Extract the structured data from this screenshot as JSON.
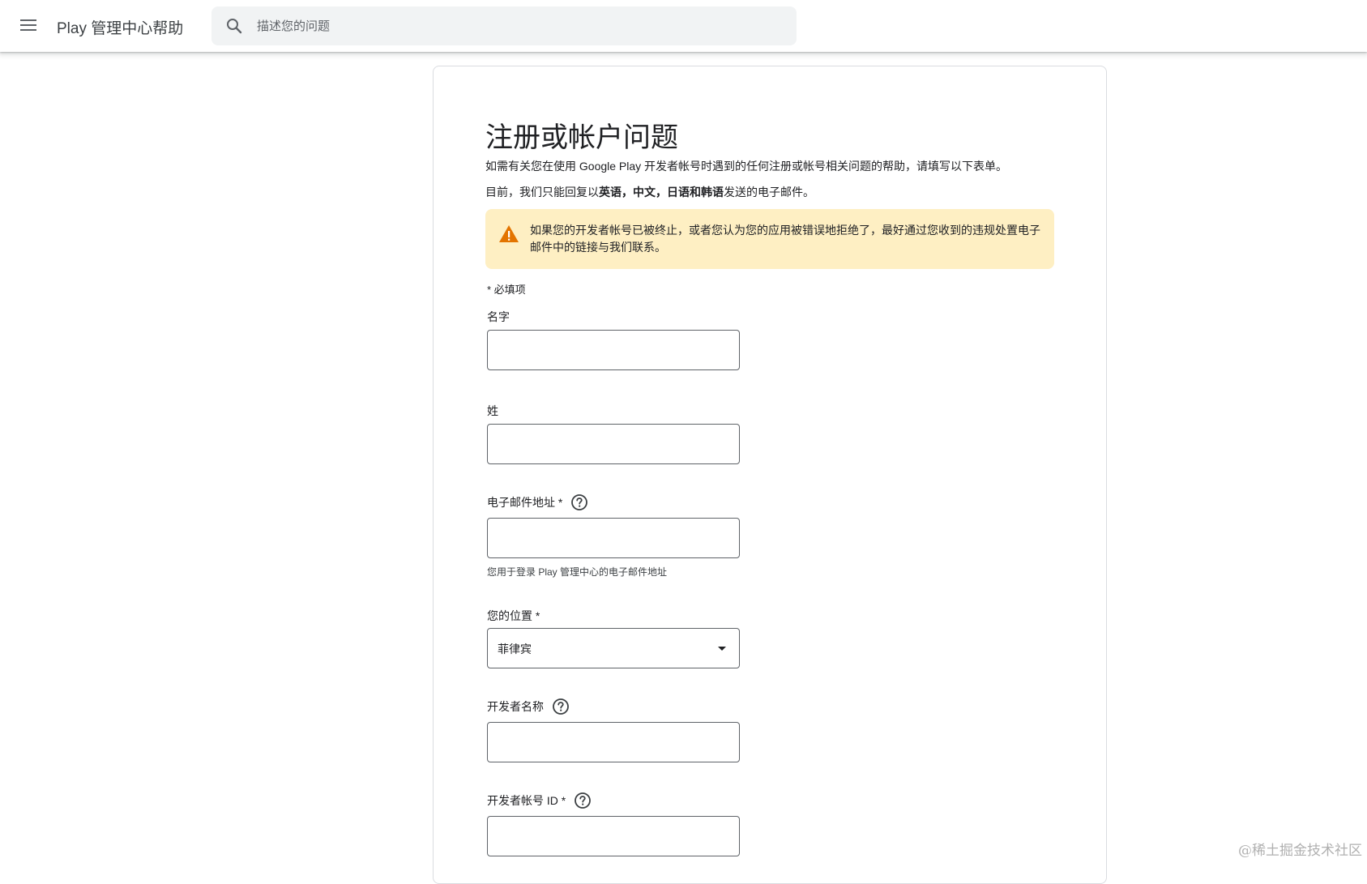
{
  "header": {
    "app_title": "Play 管理中心帮助",
    "search_placeholder": "描述您的问题"
  },
  "form": {
    "title": "注册或帐户问题",
    "intro": "如需有关您在使用 Google Play 开发者帐号时遇到的任何注册或帐号相关问题的帮助，请填写以下表单。",
    "lang_prefix": "目前，我们只能回复以",
    "lang_english": "英语",
    "lang_sep1": "，",
    "lang_chinese": "中文",
    "lang_sep2": "，",
    "lang_japanese_korean": "日语和韩语",
    "lang_suffix": "发送的电子邮件。",
    "warning": "如果您的开发者帐号已被终止，或者您认为您的应用被错误地拒绝了，最好通过您收到的违规处置电子邮件中的链接与我们联系。",
    "required_note": "* 必填项",
    "fields": {
      "first_name": {
        "label": "名字",
        "value": ""
      },
      "last_name": {
        "label": "姓",
        "value": ""
      },
      "email": {
        "label": "电子邮件地址 *",
        "value": "",
        "hint": "您用于登录 Play 管理中心的电子邮件地址"
      },
      "location": {
        "label": "您的位置 *",
        "value": "菲律宾"
      },
      "developer_name": {
        "label": "开发者名称",
        "value": ""
      },
      "developer_id": {
        "label": "开发者帐号 ID *",
        "value": ""
      }
    }
  },
  "watermark": "@稀土掘金技术社区",
  "colors": {
    "warning_bg": "#feefc3",
    "warning_icon": "#e37400",
    "border": "#dadce0",
    "input_border": "#5f6368"
  },
  "icons": {
    "menu": "menu-icon",
    "search": "search-icon",
    "warning": "warning-icon",
    "help": "help-icon",
    "dropdown": "chevron-down-icon"
  }
}
